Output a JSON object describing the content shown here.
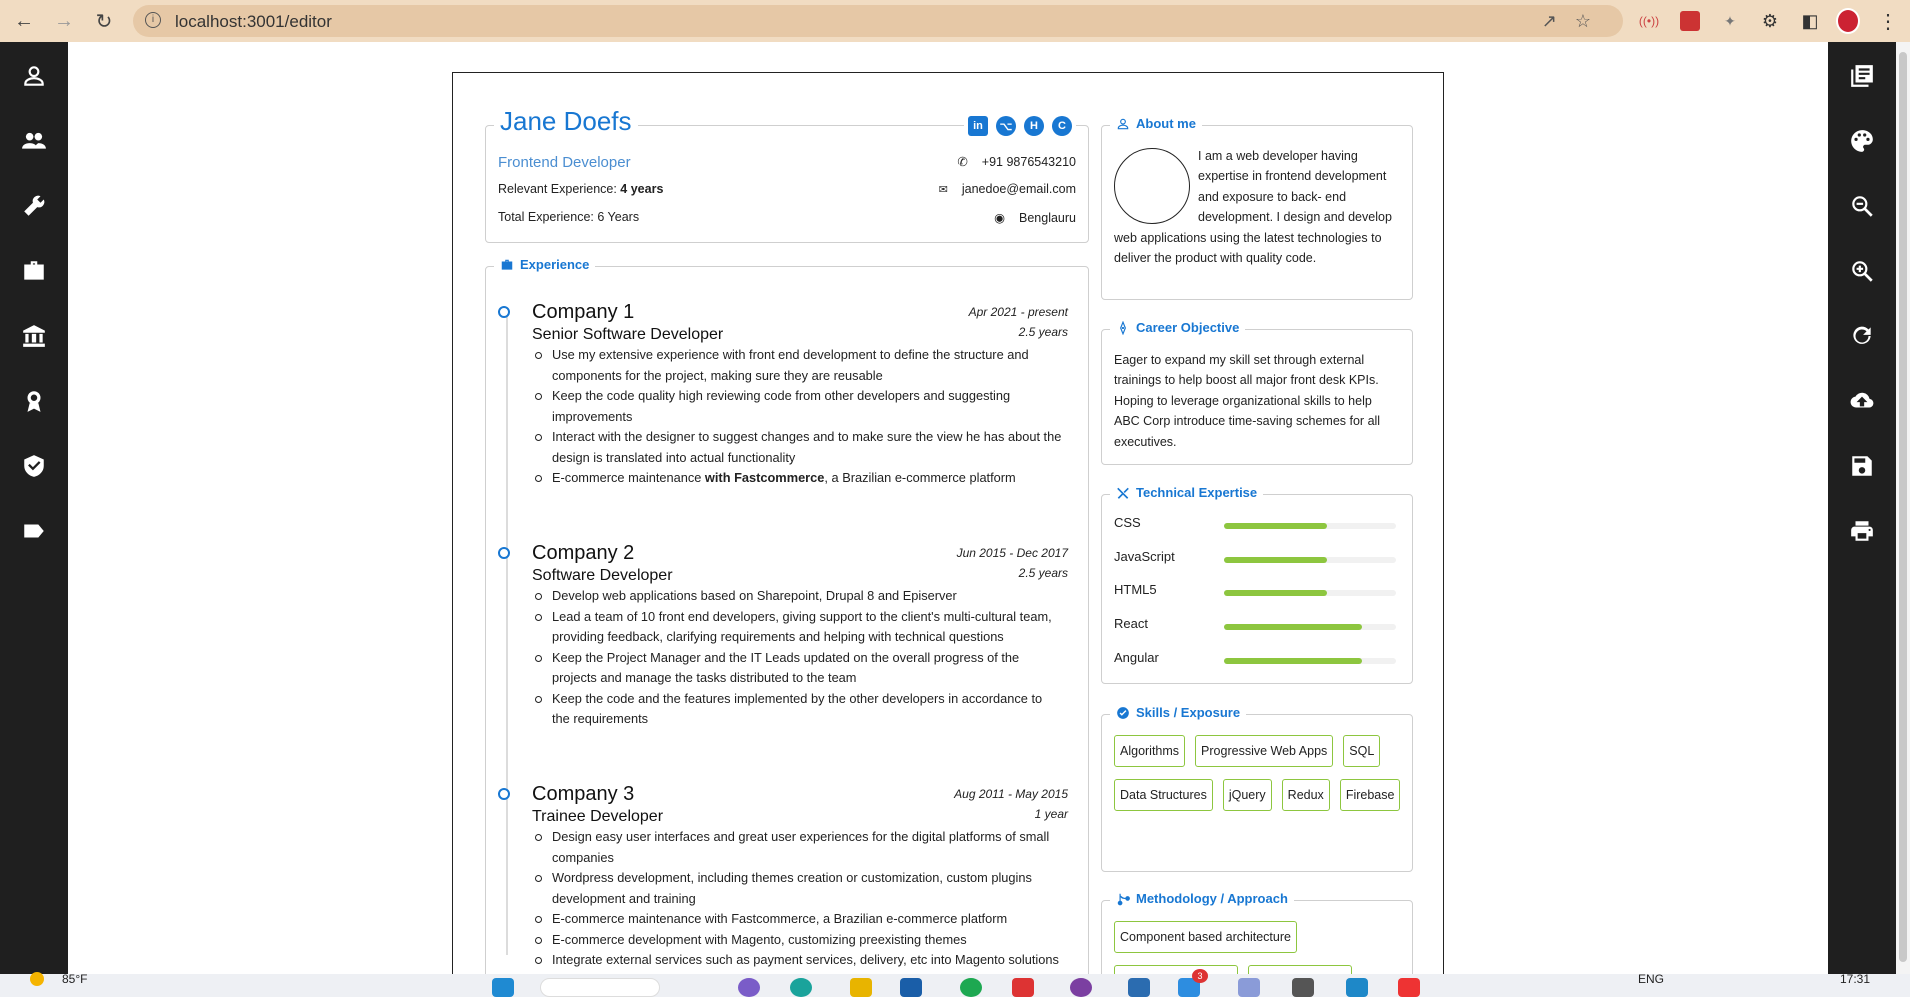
{
  "browser": {
    "url": "localhost:3001/editor",
    "icons": [
      "back-icon",
      "forward-icon",
      "reload-icon",
      "info-icon",
      "share-icon",
      "star-icon",
      "extension-icon",
      "puzzle-icon",
      "sidepanel-icon",
      "profile-avatar",
      "kebab-menu-icon"
    ]
  },
  "left_sidebar": [
    "user-icon",
    "people-icon",
    "wrench-icon",
    "briefcase-icon",
    "bank-icon",
    "award-icon",
    "shield-icon",
    "label-icon"
  ],
  "right_sidebar": [
    "template-icon",
    "palette-icon",
    "zoom-out-icon",
    "zoom-in-icon",
    "reset-icon",
    "upload-icon",
    "save-icon",
    "print-icon"
  ],
  "resume": {
    "header": {
      "name": "Jane Doefs",
      "role": "Frontend Developer",
      "relevant_label": "Relevant Experience: ",
      "relevant_value": "4 years",
      "total": "Total Experience: 6 Years",
      "phone": "+91 9876543210",
      "email": "janedoe@email.com",
      "location": "Benglauru",
      "socials": [
        "in",
        "⌥",
        "H",
        "C"
      ]
    },
    "experience": {
      "title": "Experience",
      "jobs": [
        {
          "company": "Company 1",
          "title": "Senior Software Developer",
          "dates": "Apr 2021 - present",
          "duration": "2.5 years",
          "bullets": [
            "Use my extensive experience with front end development to define the structure and components for the project, making sure they are reusable",
            "Keep the code quality high reviewing code from other developers and suggesting improvements",
            "Interact with the designer to suggest changes and to make sure the view he has about the design is translated into actual functionality"
          ],
          "bold_bullet": {
            "pre": "E-commerce maintenance ",
            "bold": "with Fastcommerce",
            "post": ", a Brazilian e-commerce platform"
          }
        },
        {
          "company": "Company 2",
          "title": "Software Developer",
          "dates": "Jun 2015 - Dec 2017",
          "duration": "2.5 years",
          "bullets": [
            "Develop web applications based on Sharepoint, Drupal 8 and Episerver",
            "Lead a team of 10 front end developers, giving support to the client's multi-cultural team, providing feedback, clarifying requirements and helping with technical questions",
            "Keep the Project Manager and the IT Leads updated on the overall progress of the projects and manage the tasks distributed to the team",
            "Keep the code and the features implemented by the other developers in accordance to the requirements"
          ]
        },
        {
          "company": "Company 3",
          "title": "Trainee Developer",
          "dates": "Aug 2011 - May 2015",
          "duration": "1 year",
          "bullets": [
            "Design easy user interfaces and great user experiences for the digital platforms of small companies",
            "Wordpress development, including themes creation or customization, custom plugins development and training",
            "E-commerce maintenance with Fastcommerce, a Brazilian e-commerce platform",
            "E-commerce development with Magento, customizing preexisting themes",
            "Integrate external services such as payment services, delivery, etc into Magento solutions"
          ]
        }
      ]
    },
    "about": {
      "title": "About me",
      "text": "I am a web developer having expertise in frontend development and exposure to back- end development. I design and develop web applications using the latest technologies to deliver the product with quality code."
    },
    "objective": {
      "title": "Career Objective",
      "text": "Eager to expand my skill set through external trainings to help boost all major front desk KPIs. Hoping to leverage organizational skills to help ABC Corp introduce time-saving schemes for all executives."
    },
    "technical": {
      "title": "Technical Expertise",
      "skills": [
        {
          "name": "CSS",
          "level": 0.6
        },
        {
          "name": "JavaScript",
          "level": 0.6
        },
        {
          "name": "HTML5",
          "level": 0.6
        },
        {
          "name": "React",
          "level": 0.8
        },
        {
          "name": "Angular",
          "level": 0.8
        }
      ]
    },
    "skills": {
      "title": "Skills / Exposure",
      "items": [
        "Algorithms",
        "Progressive Web Apps",
        "SQL",
        "Data Structures",
        "jQuery",
        "Redux",
        "Firebase"
      ]
    },
    "methodology": {
      "title": "Methodology / Approach",
      "items": [
        "Component based architecture"
      ]
    }
  },
  "taskbar": {
    "weather": "85°F",
    "lang": "ENG",
    "time": "17:31",
    "badge": "3"
  }
}
